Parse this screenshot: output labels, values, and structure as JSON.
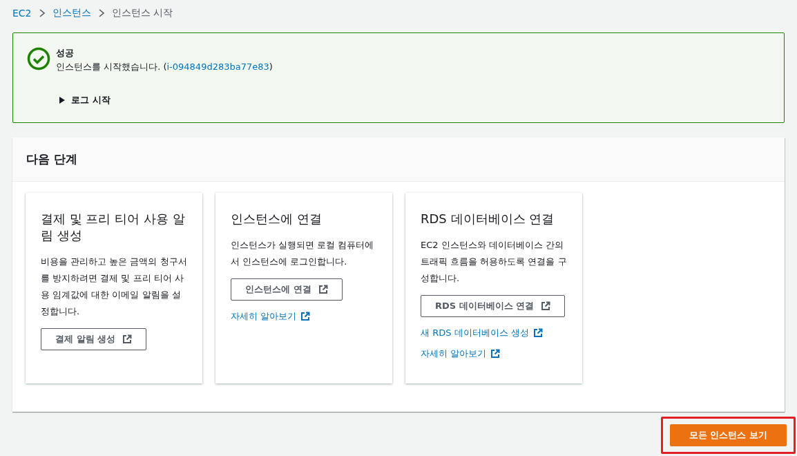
{
  "breadcrumb": [
    {
      "label": "EC2",
      "kind": "link"
    },
    {
      "label": "인스턴스",
      "kind": "link"
    },
    {
      "label": "인스턴스 시작",
      "kind": "current"
    }
  ],
  "alert": {
    "title": "성공",
    "message": "인스턴스를 시작했습니다. (",
    "instance_id": "i-094849d283ba77e83",
    "message_end": ")",
    "log": {
      "label": "로그 시작",
      "expanded": false
    }
  },
  "next_steps": {
    "title": "다음 단계",
    "cards": [
      {
        "title": "결제 및 프리 티어 사용 알림 생성",
        "description": "비용을 관리하고 높은 금액의 청구서를 방지하려면 결제 및 프리 티어 사용 임계값에 대한 이메일 알림을 설정합니다.",
        "button": "결제 알림 생성"
      },
      {
        "title": "인스턴스에 연결",
        "description": "인스턴스가 실행되면 로컬 컴퓨터에서 인스턴스에 로그인합니다.",
        "button": "인스턴스에 연결",
        "links": [
          "자세히 알아보기"
        ]
      },
      {
        "title": "RDS 데이터베이스 연결",
        "description": "EC2 인스턴스와 데이터베이스 간의 트래픽 흐름을 허용하도록 연결을 구성합니다.",
        "button": "RDS 데이터베이스 연결",
        "links": [
          "새 RDS 데이터베이스 생성",
          "자세히 알아보기"
        ]
      }
    ]
  },
  "primary_button": {
    "label": "모든 인스턴스 보기",
    "highlighted": true
  }
}
